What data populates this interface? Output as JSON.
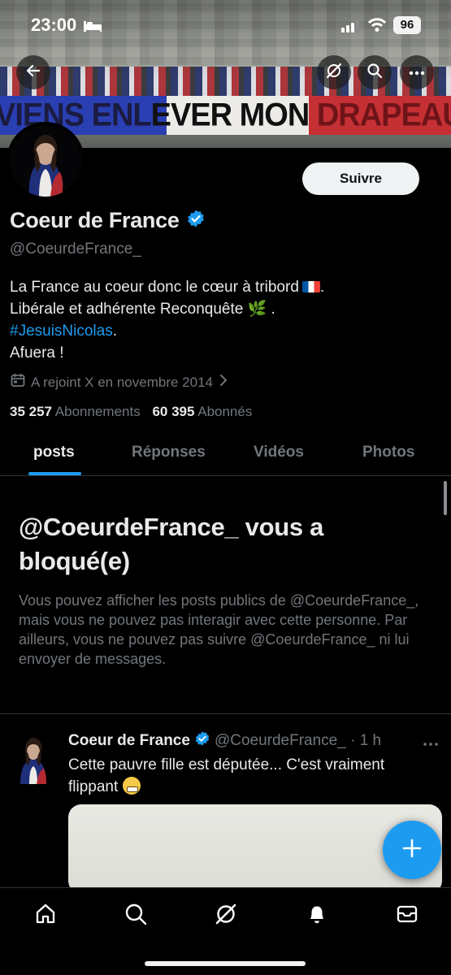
{
  "status_bar": {
    "time": "23:00",
    "battery": "96"
  },
  "banner": {
    "slogan_part1": "VIENS ENL",
    "slogan_part2": "EVER MON ",
    "slogan_part3": "DRAPEAU"
  },
  "header_icons": {
    "back": "back-arrow-icon",
    "grok": "grok-icon",
    "search": "search-icon",
    "more": "more-icon"
  },
  "profile": {
    "display_name": "Coeur de France",
    "handle": "@CoeurdeFrance_",
    "follow_label": "Suivre",
    "bio_line1": "La France au coeur donc le cœur à tribord",
    "bio_line2": "Libérale et adhérente Reconquête 🌿 .",
    "bio_hashtag": "#JesuisNicolas",
    "bio_hashtag_suffix": ".",
    "bio_line4": "Afuera !",
    "joined": "A rejoint X en novembre 2014",
    "following_count": "35 257",
    "following_label": "Abonnements",
    "followers_count": "60 395",
    "followers_label": "Abonnés"
  },
  "tabs": [
    {
      "label": "posts",
      "active": true
    },
    {
      "label": "Réponses",
      "active": false
    },
    {
      "label": "Vidéos",
      "active": false
    },
    {
      "label": "Photos",
      "active": false
    }
  ],
  "blocked": {
    "title": "@CoeurdeFrance_ vous a bloqué(e)",
    "description": "Vous pouvez afficher les posts publics de @CoeurdeFrance_, mais vous ne pouvez pas interagir avec cette personne. Par ailleurs, vous ne pouvez pas suivre @CoeurdeFrance_ ni lui envoyer de messages."
  },
  "post": {
    "author": "Coeur de France",
    "handle_time": "@CoeurdeFrance_ · 1 h",
    "text": "Cette pauvre fille est députée... C'est vraiment flippant"
  },
  "colors": {
    "accent": "#1d9bf0",
    "background": "#000000",
    "text_primary": "#e7e9ea",
    "text_secondary": "#71767b",
    "border": "#2f3336"
  },
  "bottom_nav": [
    "home-icon",
    "search-icon",
    "grok-icon",
    "notifications-icon",
    "messages-icon"
  ]
}
